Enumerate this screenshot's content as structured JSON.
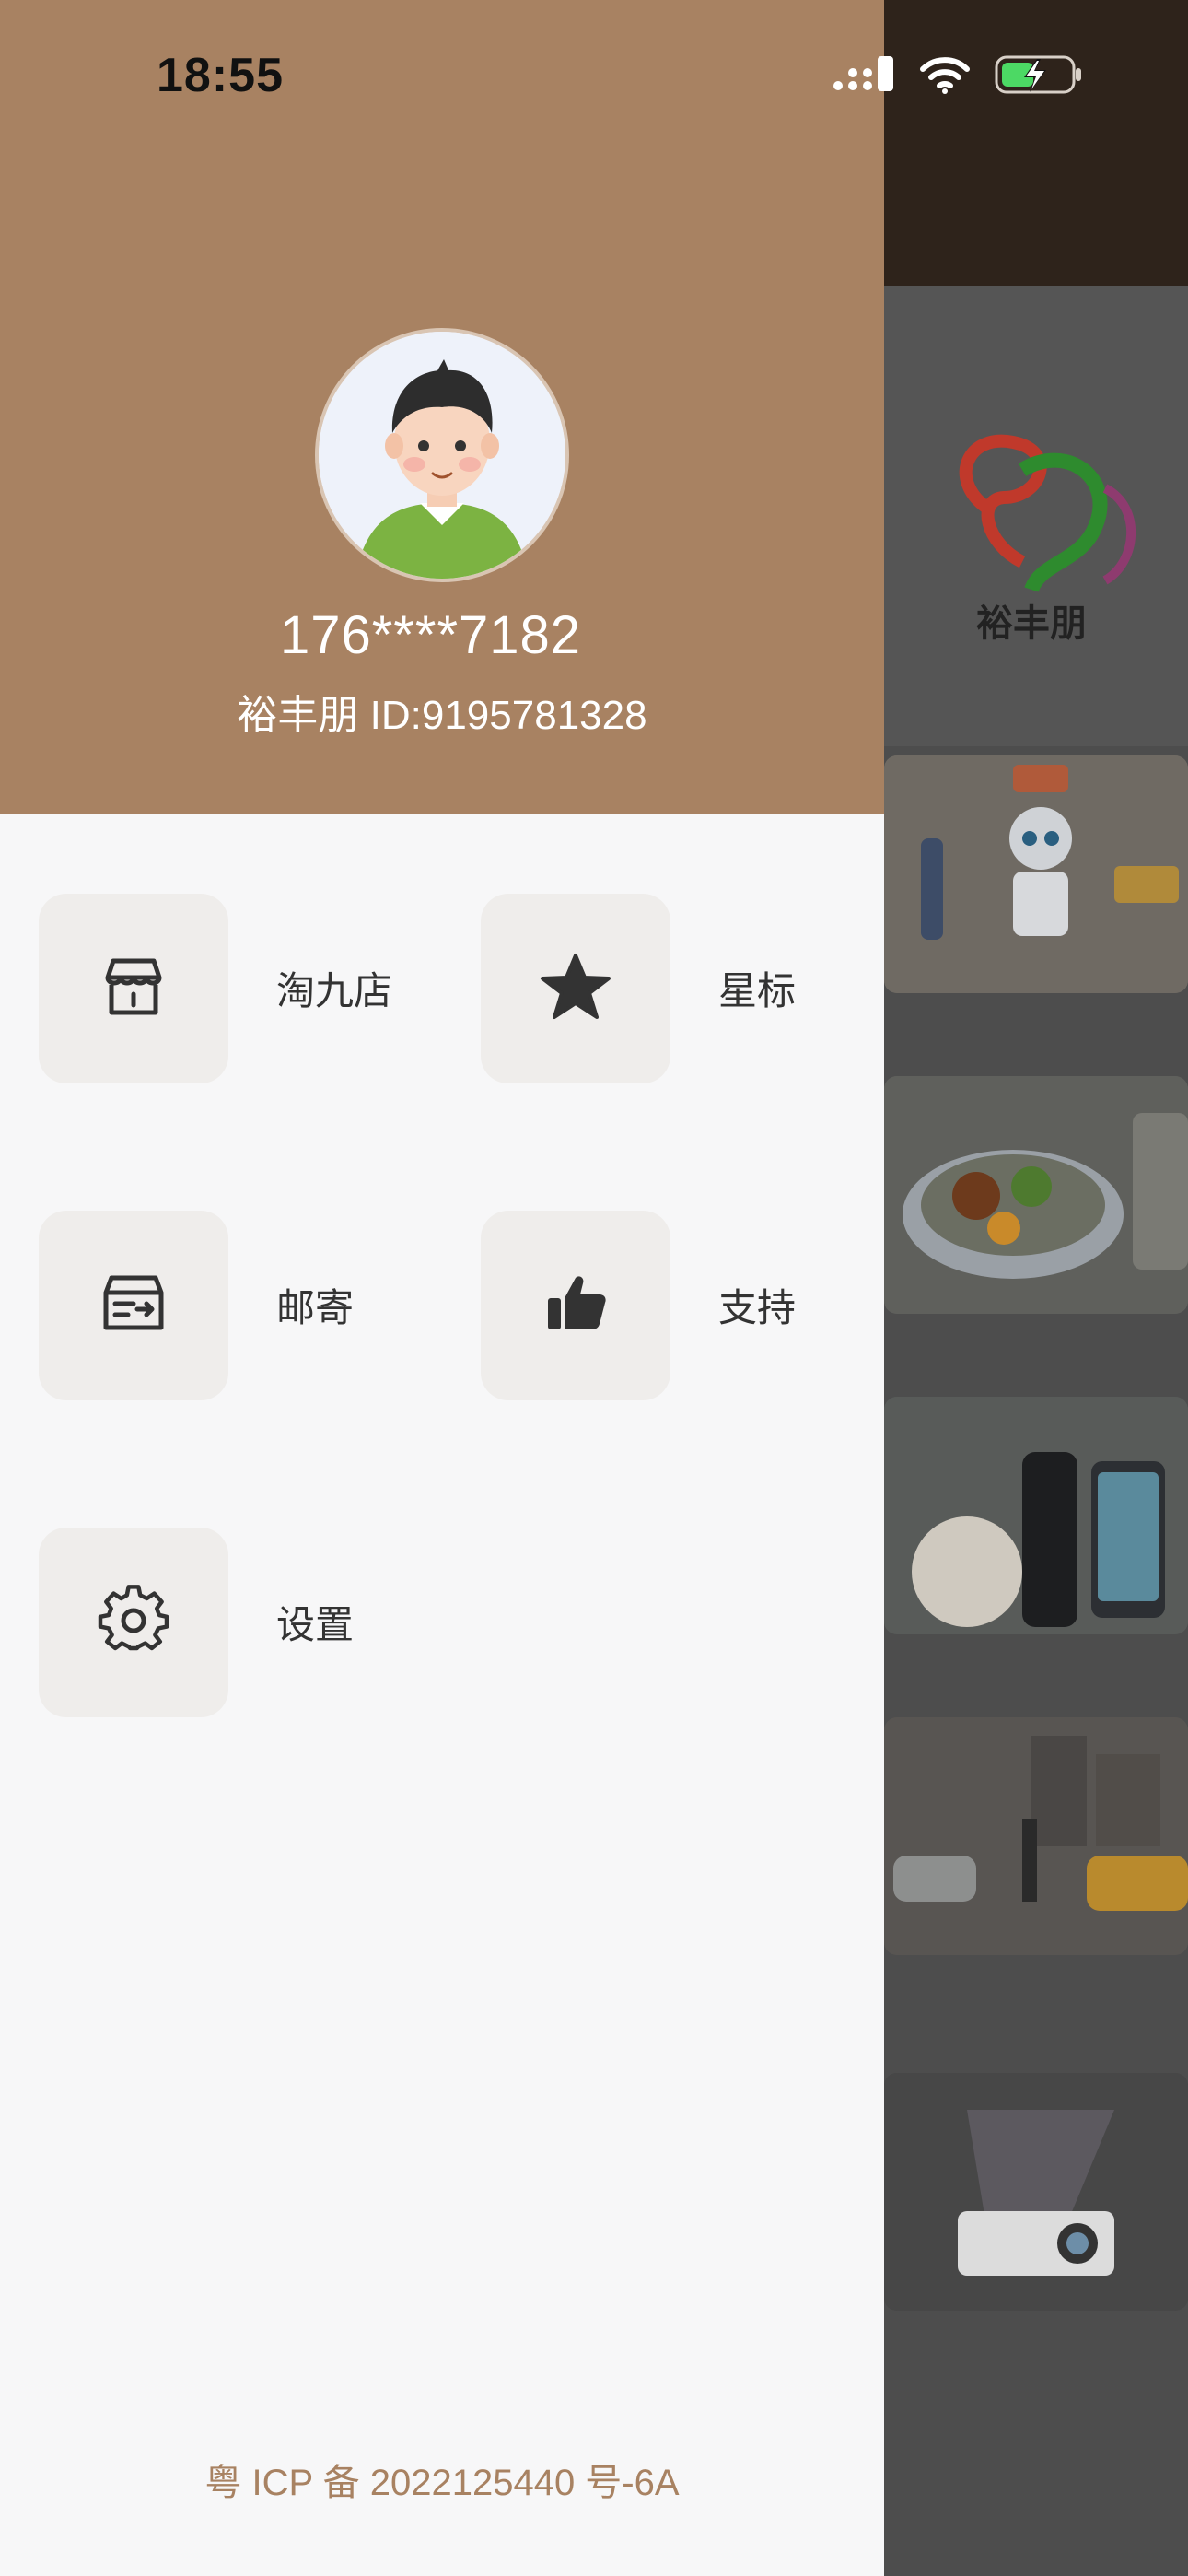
{
  "status_bar": {
    "time": "18:55",
    "battery_charging": true
  },
  "drawer": {
    "header_color": "#a88262",
    "user": {
      "phone": "176****7182",
      "id_label": "裕丰朋 ID:9195781328"
    },
    "menu": [
      {
        "icon": "store-icon",
        "label": "淘九店"
      },
      {
        "icon": "star-icon",
        "label": "星标"
      },
      {
        "icon": "mail-box-icon",
        "label": "邮寄"
      },
      {
        "icon": "thumbs-up-icon",
        "label": "支持"
      },
      {
        "icon": "gear-icon",
        "label": "设置"
      }
    ],
    "footer": "粤 ICP 备 2022125440 号-6A"
  },
  "background": {
    "logo_text": "裕丰朋"
  }
}
